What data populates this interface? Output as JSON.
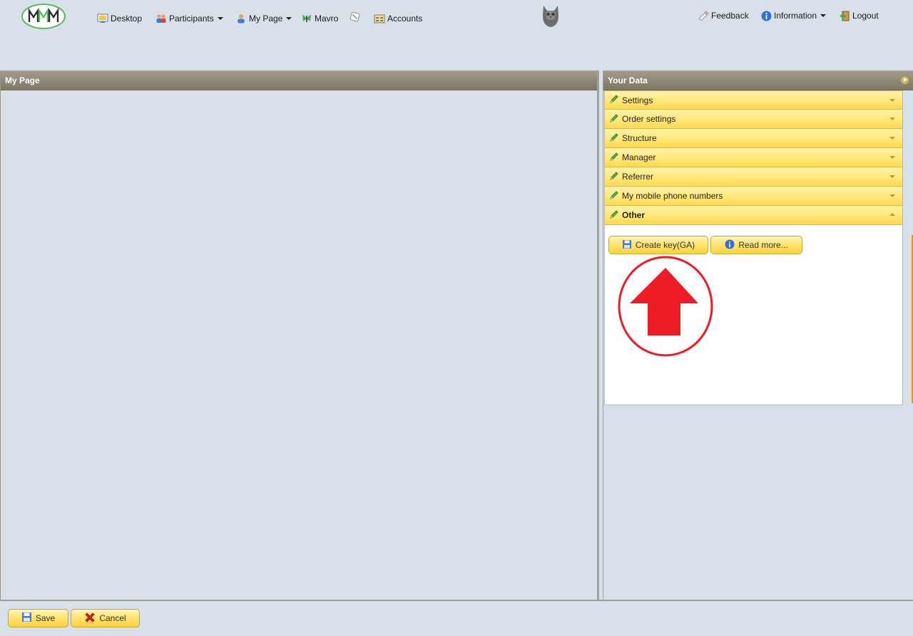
{
  "topnav": {
    "desktop": "Desktop",
    "participants": "Participants",
    "my_page": "My Page",
    "mavro": "Mavro",
    "accounts": "Accounts",
    "feedback": "Feedback",
    "information": "Information",
    "logout": "Logout"
  },
  "left_panel": {
    "title": "My Page"
  },
  "right_panel": {
    "title": "Your Data",
    "sections": [
      "Settings",
      "Order settings",
      "Structure",
      "Manager",
      "Referrer",
      "My mobile phone numbers",
      "Other"
    ],
    "open_section": "Other",
    "buttons": {
      "create_key": "Create key(GA)",
      "read_more": "Read more..."
    }
  },
  "footer": {
    "save": "Save",
    "cancel": "Cancel"
  },
  "colors": {
    "background": "#d8e0ea",
    "header_bar": "#8c8573",
    "accordion_yellow": "#ffe77a",
    "annotation_red": "#ed1c24",
    "logo_green": "#5cb85c"
  },
  "icons": [
    "mmm-logo",
    "desktop-icon",
    "participants-icon",
    "user-icon",
    "mavro-icon",
    "dice-icon",
    "accounts-icon",
    "owl-icon",
    "feedback-icon",
    "info-icon",
    "logout-icon",
    "pencil-icon",
    "save-icon",
    "cancel-icon",
    "red-up-arrow-annotation"
  ]
}
